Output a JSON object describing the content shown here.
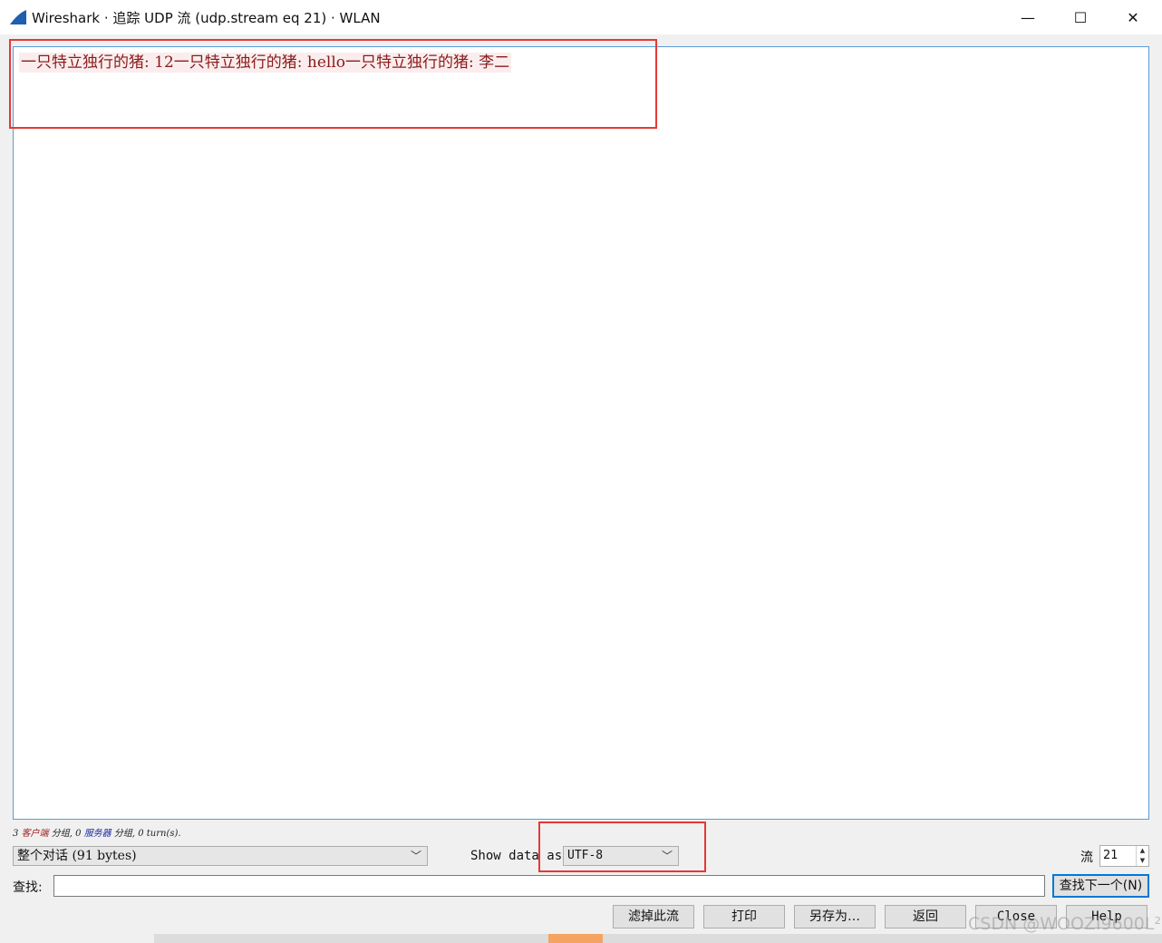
{
  "window": {
    "title": "Wireshark · 追踪 UDP 流 (udp.stream eq 21) · WLAN",
    "minimize_glyph": "—",
    "maximize_glyph": "☐",
    "close_glyph": "✕"
  },
  "stream": {
    "text": "一只特立独行的猪: 12一只特立独行的猪: hello一只特立独行的猪: 李二"
  },
  "stats": {
    "client_count": "3",
    "client_label": "客户端",
    "packets_word_1": "分组,",
    "server_count": "0",
    "server_label": "服务器",
    "packets_word_2": "分组,",
    "turns": "0 turn(s)."
  },
  "conversation": {
    "selected": "整个对话 (91 bytes)"
  },
  "show_data": {
    "label": "Show data as",
    "selected": "UTF-8"
  },
  "stream_number": {
    "label": "流",
    "value": "21"
  },
  "find": {
    "label": "查找:",
    "value": "",
    "next_label": "查找下一个(N)"
  },
  "buttons": {
    "filter_out": "滤掉此流",
    "print": "打印",
    "save_as": "另存为…",
    "back": "返回",
    "close": "Close",
    "help": "Help"
  },
  "watermark": "CSDN @WOOZI9600L²"
}
